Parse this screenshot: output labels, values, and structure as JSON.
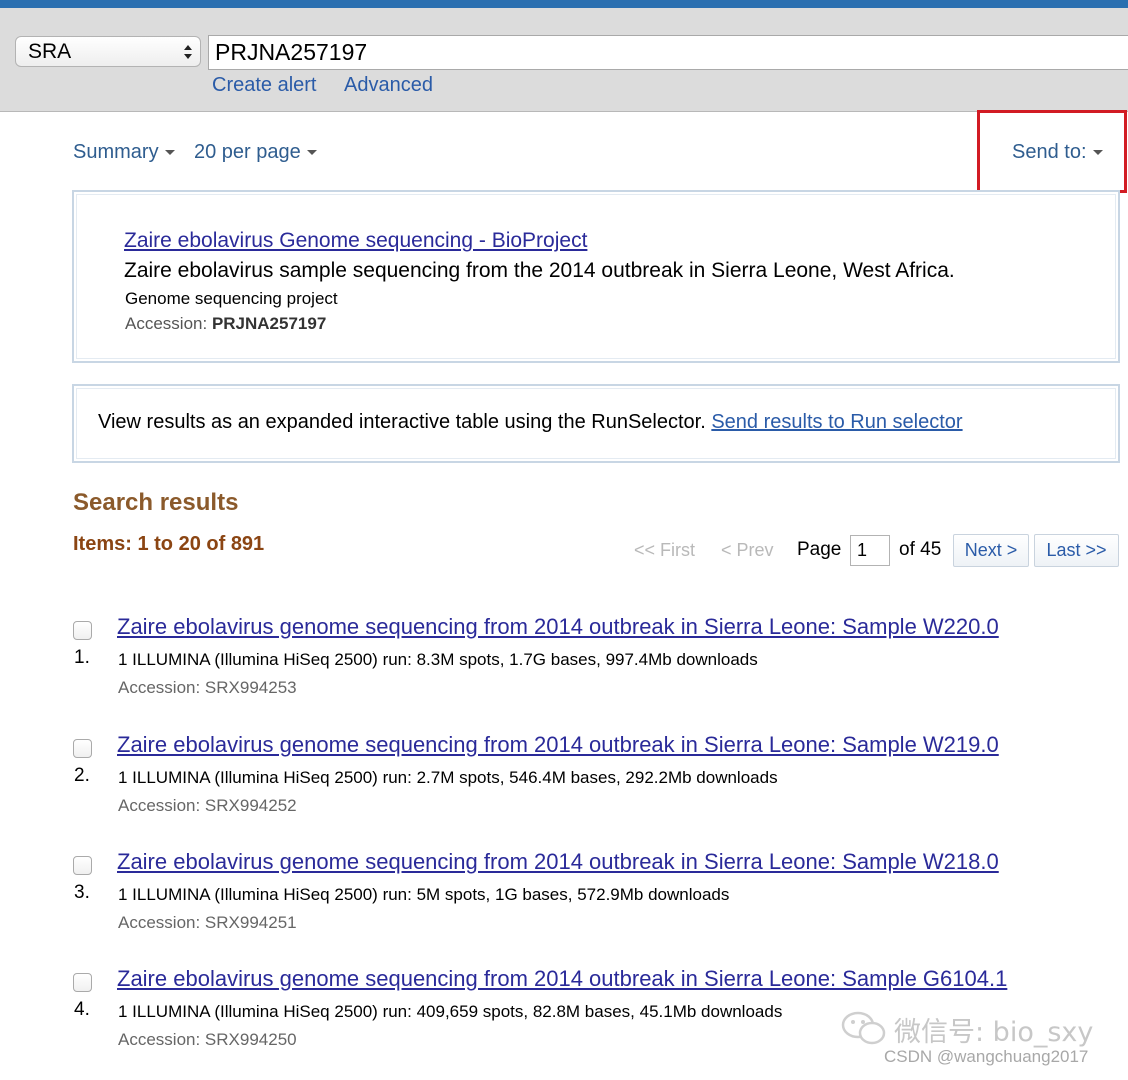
{
  "search": {
    "database": "SRA",
    "term": "PRJNA257197",
    "links": [
      "Create alert",
      "Advanced"
    ]
  },
  "toolbar": {
    "format": "Summary",
    "per_page": "20 per page",
    "send_to": "Send to:"
  },
  "bioproject": {
    "title": "Zaire ebolavirus Genome sequencing - BioProject",
    "description": "Zaire ebolavirus sample sequencing from the 2014 outbreak in Sierra Leone, West Africa.",
    "type": "Genome sequencing project",
    "accession_label": "Accession: ",
    "accession": "PRJNA257197"
  },
  "runselector": {
    "text": "View results as an expanded interactive table using the RunSelector. ",
    "link": "Send results to Run selector"
  },
  "results": {
    "heading": "Search results",
    "count": "Items: 1 to 20 of 891",
    "pager": {
      "first": "<< First",
      "prev": "< Prev",
      "page_label": "Page",
      "page_value": "1",
      "of": "of 45",
      "next": "Next >",
      "last": "Last >>"
    },
    "items": [
      {
        "num": "1.",
        "title": "Zaire ebolavirus genome sequencing from 2014 outbreak in Sierra Leone: Sample W220.0",
        "desc": "1 ILLUMINA (Illumina HiSeq 2500) run: 8.3M spots, 1.7G bases, 997.4Mb downloads",
        "accession": "Accession: SRX994253"
      },
      {
        "num": "2.",
        "title": "Zaire ebolavirus genome sequencing from 2014 outbreak in Sierra Leone: Sample W219.0",
        "desc": "1 ILLUMINA (Illumina HiSeq 2500) run: 2.7M spots, 546.4M bases, 292.2Mb downloads",
        "accession": "Accession: SRX994252"
      },
      {
        "num": "3.",
        "title": "Zaire ebolavirus genome sequencing from 2014 outbreak in Sierra Leone: Sample W218.0",
        "desc": "1 ILLUMINA (Illumina HiSeq 2500) run: 5M spots, 1G bases, 572.9Mb downloads",
        "accession": "Accession: SRX994251"
      },
      {
        "num": "4.",
        "title": "Zaire ebolavirus genome sequencing from 2014 outbreak in Sierra Leone: Sample G6104.1",
        "desc": "1 ILLUMINA (Illumina HiSeq 2500) run: 409,659 spots, 82.8M bases, 45.1Mb downloads",
        "accession": "Accession: SRX994250"
      }
    ]
  },
  "watermark": {
    "wechat": "微信号: bio_sxy",
    "csdn": "CSDN @wangchuang2017"
  },
  "colors": {
    "topbar": "#2a6fb0",
    "highlight_box": "#d21b23",
    "link": "#2a2a99",
    "heading": "#8b5a2b"
  }
}
